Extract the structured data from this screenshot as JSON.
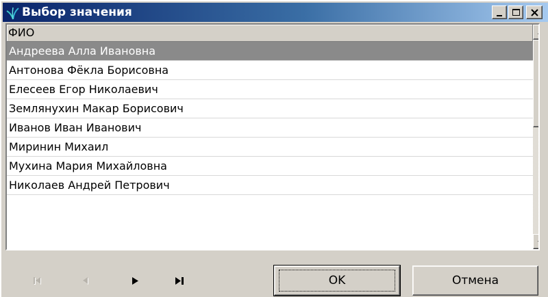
{
  "window": {
    "title": "Выбор значения",
    "icon": "app-feather-icon",
    "controls": [
      "minimize-icon",
      "maximize-icon",
      "close-icon"
    ]
  },
  "list": {
    "column_header": "ФИО",
    "rows": [
      {
        "label": "Андреева Алла Ивановна",
        "selected": true
      },
      {
        "label": "Антонова Фёкла Борисовна",
        "selected": false
      },
      {
        "label": "Елесеев Егор Николаевич",
        "selected": false
      },
      {
        "label": "Землянухин Макар Борисович",
        "selected": false
      },
      {
        "label": "Иванов Иван Иванович",
        "selected": false
      },
      {
        "label": "Миринин Михаил",
        "selected": false
      },
      {
        "label": "Мухина Мария Михайловна",
        "selected": false
      },
      {
        "label": "Николаев Андрей Петрович",
        "selected": false
      }
    ]
  },
  "navigation": {
    "first": {
      "icon": "first-record-icon",
      "enabled": false
    },
    "prev": {
      "icon": "prev-record-icon",
      "enabled": false
    },
    "next": {
      "icon": "next-record-icon",
      "enabled": true
    },
    "last": {
      "icon": "last-record-icon",
      "enabled": true
    }
  },
  "buttons": {
    "ok_label": "OK",
    "cancel_label": "Отмена"
  },
  "colors": {
    "titlebar_start": "#0a246a",
    "titlebar_end": "#a6caf0",
    "selection": "#8a8a8a",
    "face": "#d4d0c8"
  }
}
